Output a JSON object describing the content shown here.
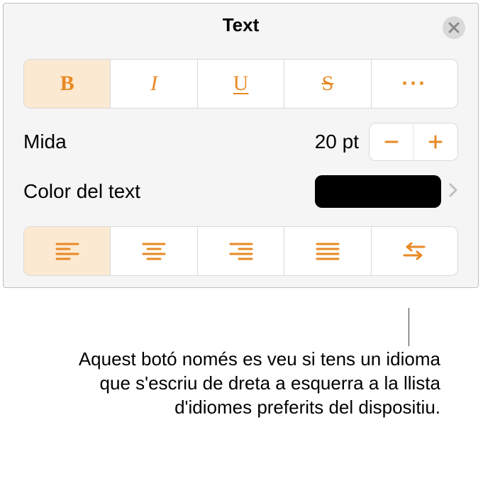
{
  "header": {
    "title": "Text"
  },
  "style_buttons": {
    "bold_glyph": "B",
    "italic_glyph": "I",
    "underline_glyph": "U",
    "strike_glyph": "S",
    "more_glyph": "···"
  },
  "size_row": {
    "label": "Mida",
    "value": "20 pt"
  },
  "color_row": {
    "label": "Color del text",
    "swatch_color": "#000000"
  },
  "callout": {
    "text": "Aquest botó només es veu si tens un idioma que s'escriu de dreta a esquerra a la llista d'idiomes preferits del dispositiu."
  }
}
